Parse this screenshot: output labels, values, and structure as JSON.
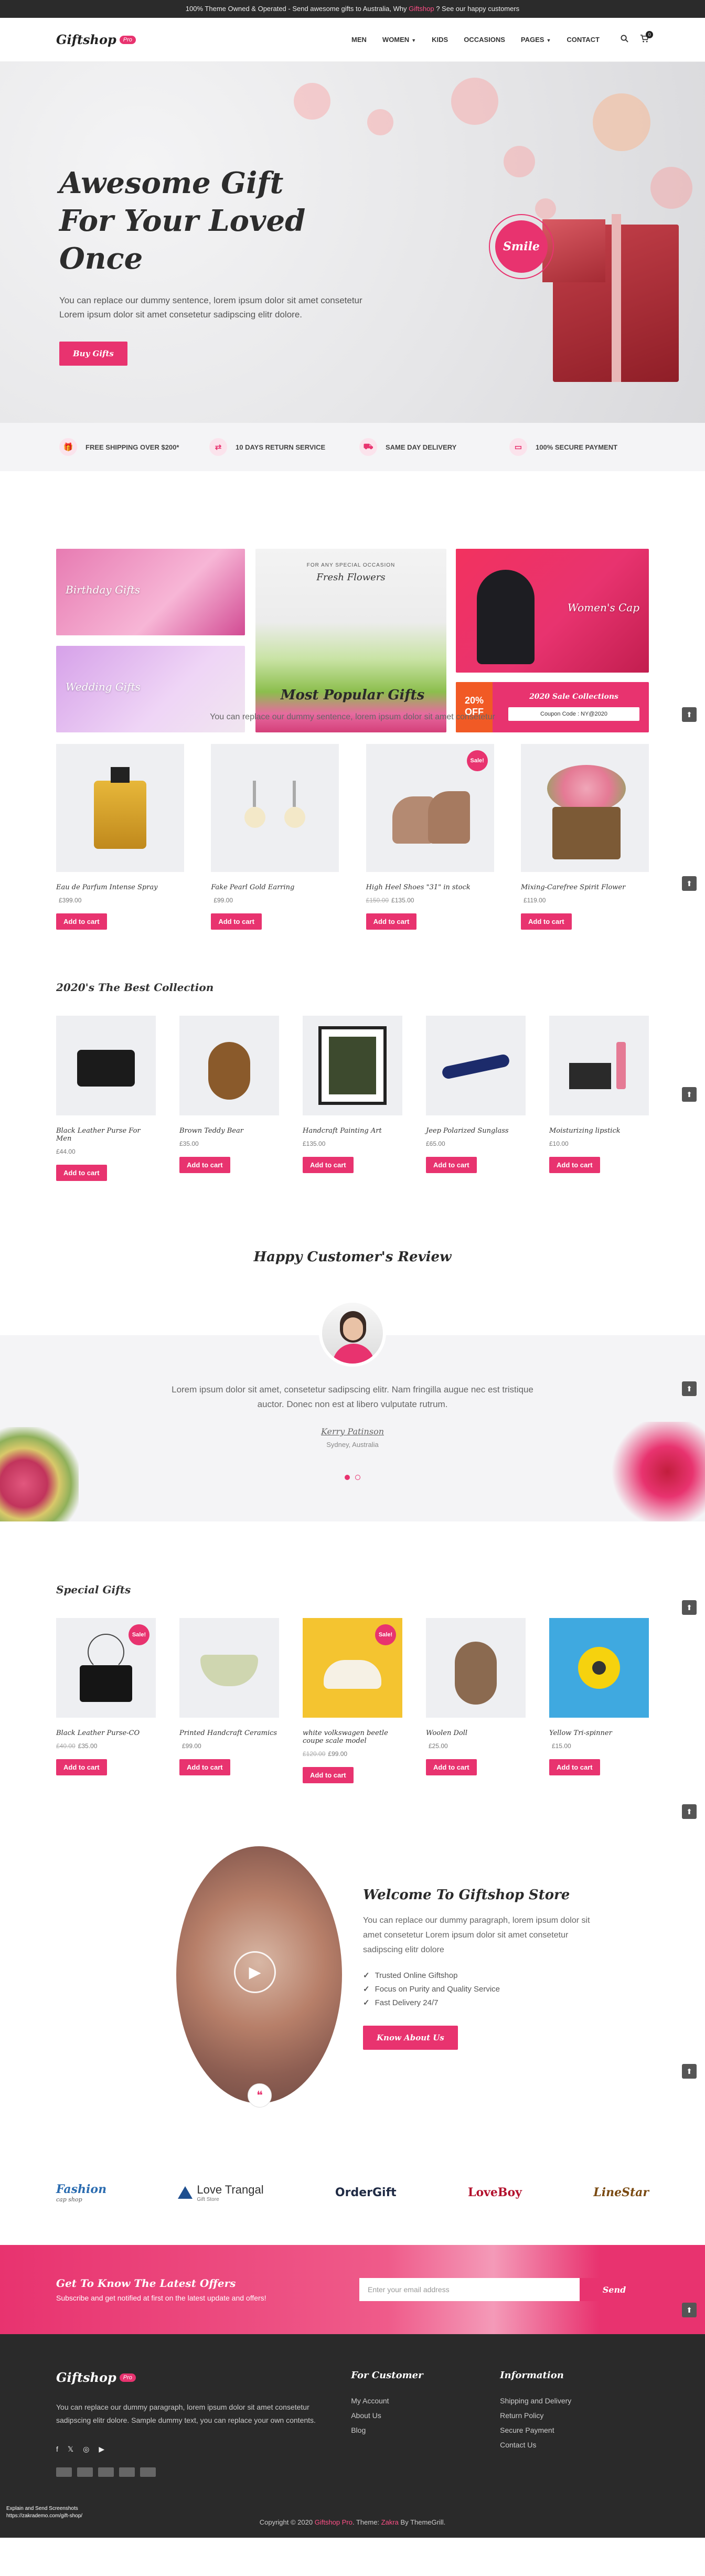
{
  "topbar": {
    "text_pre": "100% Theme Owned & Operated - Send awesome gifts to Australia, Why ",
    "brand": "Giftshop",
    "text_post": " ? See our happy customers"
  },
  "header": {
    "logo": "Giftshop",
    "logo_badge": "Pro",
    "nav": [
      {
        "label": "MEN",
        "caret": ""
      },
      {
        "label": "WOMEN",
        "caret": "▼"
      },
      {
        "label": "KIDS",
        "caret": ""
      },
      {
        "label": "OCCASIONS",
        "caret": ""
      },
      {
        "label": "PAGES",
        "caret": "▼"
      },
      {
        "label": "CONTACT",
        "caret": ""
      }
    ],
    "cart_count": "0"
  },
  "hero": {
    "title_line1": "Awesome Gift",
    "title_line2": "For Your Loved Once",
    "text": "You can replace our dummy sentence, lorem ipsum dolor sit amet consetetur Lorem ipsum dolor sit amet consetetur sadipscing elitr dolore.",
    "button": "Buy Gifts",
    "badge": "Smile"
  },
  "features": [
    {
      "icon": "gift-icon",
      "glyph": "🎁",
      "label": "FREE SHIPPING OVER $200*"
    },
    {
      "icon": "return-icon",
      "glyph": "⇄",
      "label": "10 DAYS RETURN SERVICE"
    },
    {
      "icon": "delivery-icon",
      "glyph": "⛟",
      "label": "SAME DAY DELIVERY"
    },
    {
      "icon": "secure-payment-icon",
      "glyph": "▭",
      "label": "100% SECURE PAYMENT"
    }
  ],
  "banners": {
    "birthday": "Birthday Gifts",
    "wedding": "Wedding Gifts",
    "flowers_sub": "FOR ANY SPECIAL OCCASION",
    "flowers": "Fresh Flowers",
    "womens_cap": "Women's Cap",
    "sale_pct": "20%",
    "sale_off": "OFF",
    "sale_title": "2020 Sale Collections",
    "coupon": "Coupon Code : NY@2020"
  },
  "popular": {
    "title": "Most Popular Gifts",
    "subtitle": "You can replace our dummy sentence, lorem ipsum dolor sit amet consetetur",
    "items": [
      {
        "name": "Eau de Parfum Intense Spray",
        "old": "",
        "price": "£399.00",
        "sale": ""
      },
      {
        "name": "Fake Pearl Gold Earring",
        "old": "",
        "price": "£99.00",
        "sale": ""
      },
      {
        "name": "High Heel Shoes \"31\" in stock",
        "old": "£150.00",
        "price": "£135.00",
        "sale": "Sale!"
      },
      {
        "name": "Mixing-Carefree Spirit Flower",
        "old": "",
        "price": "£119.00",
        "sale": ""
      }
    ]
  },
  "collection": {
    "title": "2020's The Best Collection",
    "items": [
      {
        "name": "Black Leather Purse For Men",
        "price": "£44.00"
      },
      {
        "name": "Brown Teddy Bear",
        "price": "£35.00"
      },
      {
        "name": "Handcraft Painting Art",
        "price": "£135.00"
      },
      {
        "name": "Jeep Polarized Sunglass",
        "price": "£65.00"
      },
      {
        "name": "Moisturizing lipstick",
        "price": "£10.00"
      }
    ]
  },
  "add_to_cart": "Add to cart",
  "review": {
    "title": "Happy Customer's Review",
    "text": "Lorem ipsum dolor sit amet, consetetur sadipscing elitr. Nam fringilla augue nec est tristique auctor. Donec non est at libero vulputate rutrum.",
    "name": "Kerry Patinson",
    "location": "Sydney, Australia"
  },
  "special": {
    "title": "Special Gifts",
    "items": [
      {
        "name": "Black Leather Purse-CO",
        "old": "£40.00",
        "price": "£35.00",
        "sale": "Sale!"
      },
      {
        "name": "Printed Handcraft Ceramics",
        "old": "",
        "price": "£99.00",
        "sale": ""
      },
      {
        "name": "white volkswagen beetle coupe scale model",
        "old": "£120.00",
        "price": "£99.00",
        "sale": "Sale!"
      },
      {
        "name": "Woolen Doll",
        "old": "",
        "price": "£25.00",
        "sale": ""
      },
      {
        "name": "Yellow Tri-spinner",
        "old": "",
        "price": "£15.00",
        "sale": ""
      }
    ]
  },
  "welcome": {
    "title": "Welcome To Giftshop Store",
    "text": "You can replace our dummy paragraph, lorem ipsum dolor sit amet consetetur Lorem ipsum dolor sit amet consetetur sadipscing elitr dolore",
    "list": [
      "Trusted Online Giftshop",
      "Focus on Purity and Quality Service",
      "Fast Delivery 24/7"
    ],
    "button": "Know About Us"
  },
  "brands": [
    {
      "name": "Fashion",
      "sub": "cap shop",
      "color": "#2b6cb0"
    },
    {
      "name": "Love Trangal",
      "sub": "Gift Store",
      "color": "#333333"
    },
    {
      "name": "OrderGift",
      "sub": "",
      "color": "#1f2a44"
    },
    {
      "name": "LoveBoy",
      "sub": "",
      "color": "#b3122e"
    },
    {
      "name": "LineStar",
      "sub": "",
      "color": "#7a4a12"
    }
  ],
  "newsletter": {
    "title": "Get To Know The Latest Offers",
    "subtitle": "Subscribe and get notified at first on the latest update and offers!",
    "placeholder": "Enter your email address",
    "button": "Send"
  },
  "footer": {
    "logo": "Giftshop",
    "badge": "Pro",
    "desc": "You can replace our dummy paragraph, lorem ipsum dolor sit amet consetetur sadipscing elitr dolore. Sample dummy text, you can replace your own contents.",
    "col2_title": "For Customer",
    "col2": [
      "My Account",
      "About Us",
      "Blog"
    ],
    "col3_title": "Information",
    "col3": [
      "Shipping and Delivery",
      "Return Policy",
      "Secure Payment",
      "Contact Us"
    ],
    "copy_pre": "Copyright © 2020 ",
    "copy_brand": "Giftshop Pro",
    "copy_mid": ". Theme: ",
    "copy_theme": "Zakra",
    "copy_post": " By ThemeGrill.",
    "tiny1": "Explain and Send Screenshots",
    "tiny2": "https://zakrademo.com/gift-shop/"
  },
  "colors": {
    "accent": "#e8336f",
    "dark": "#2a2a2a"
  }
}
